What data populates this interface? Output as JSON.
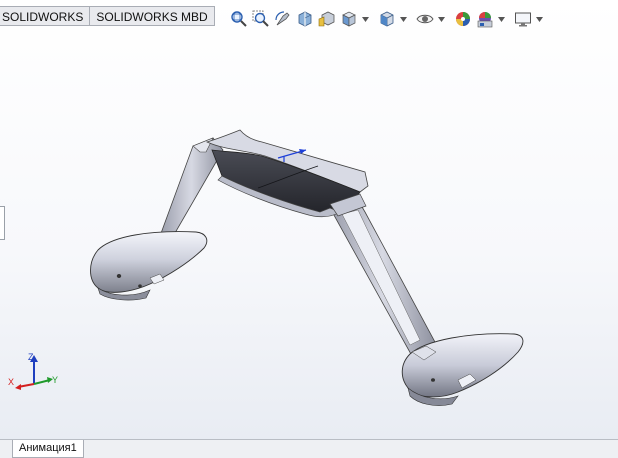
{
  "tabs": [
    {
      "label": "SOLIDWORKS"
    },
    {
      "label": "SOLIDWORKS MBD"
    }
  ],
  "hud_toolbar": {
    "icons": [
      "zoom-to-fit-icon",
      "zoom-to-area-icon",
      "previous-view-icon",
      "section-view-icon",
      "dynamic-annotation-icon",
      "view-orientation-icon",
      "display-style-icon",
      "hide-show-items-icon",
      "edit-appearance-icon",
      "apply-scene-icon",
      "view-settings-icon"
    ]
  },
  "triad": {
    "x_label": "X",
    "y_label": "Y",
    "z_label": "Z",
    "x_color": "#d42020",
    "y_color": "#1f9a2a",
    "z_color": "#1f3fbf"
  },
  "bottom_tabs": [
    {
      "label": "Анимация1"
    }
  ],
  "colors": {
    "model_face": "#c3c6d4",
    "model_shadow": "#3a3c44",
    "accent_origin": "#1d3fd8"
  }
}
